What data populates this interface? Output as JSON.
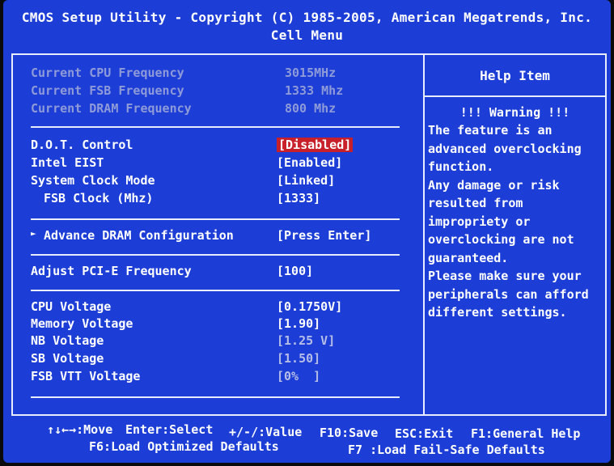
{
  "header": {
    "title": "CMOS Setup Utility - Copyright (C) 1985-2005, American Megatrends, Inc.",
    "menu": "Cell Menu"
  },
  "info": [
    {
      "label": "Current CPU Frequency",
      "value": "3015MHz"
    },
    {
      "label": "Current FSB Frequency",
      "value": "1333 Mhz"
    },
    {
      "label": "Current DRAM Frequency",
      "value": "800 Mhz"
    }
  ],
  "settings_group1": [
    {
      "label": "D.O.T. Control",
      "value": "[Disabled]"
    },
    {
      "label": "Intel EIST",
      "value": "[Enabled]"
    },
    {
      "label": "System Clock Mode",
      "value": "[Linked]"
    },
    {
      "label": "FSB Clock (Mhz)",
      "value": "[1333]"
    }
  ],
  "submenu": {
    "label": "Advance DRAM Configuration",
    "value": "[Press Enter]",
    "arrow": "►"
  },
  "pcie": {
    "label": "Adjust PCI-E Frequency",
    "value": "[100]"
  },
  "voltages": [
    {
      "label": "CPU Voltage",
      "value": "[0.1750V]"
    },
    {
      "label": "Memory Voltage",
      "value": "[1.90]"
    },
    {
      "label": "NB Voltage",
      "value": "[1.25 V]"
    },
    {
      "label": "SB Voltage",
      "value": "[1.50]"
    },
    {
      "label": "FSB VTT Voltage",
      "value": "[0%  ]"
    }
  ],
  "help": {
    "title": "Help Item",
    "warning": "!!! Warning !!!",
    "lines": [
      "The feature is an",
      "advanced overclocking",
      "function.",
      "Any damage or risk",
      "resulted from",
      "impropriety or",
      "overclocking are not",
      "guaranteed.",
      "Please make sure your",
      "peripherals can afford",
      "different settings."
    ]
  },
  "footer": {
    "move": "↑↓←→:Move",
    "enter": "Enter:Select",
    "value": "+/-/:Value",
    "f10": "F10:Save",
    "esc": "ESC:Exit",
    "f1": "F1:General Help",
    "f6": "F6:Load Optimized Defaults",
    "f7": "F7 :Load Fail-Safe Defaults"
  },
  "colors": {
    "background": "#1c3ed6",
    "highlight": "#c8202a",
    "text": "#ffffff",
    "dim_text": "#8f9ad8"
  }
}
